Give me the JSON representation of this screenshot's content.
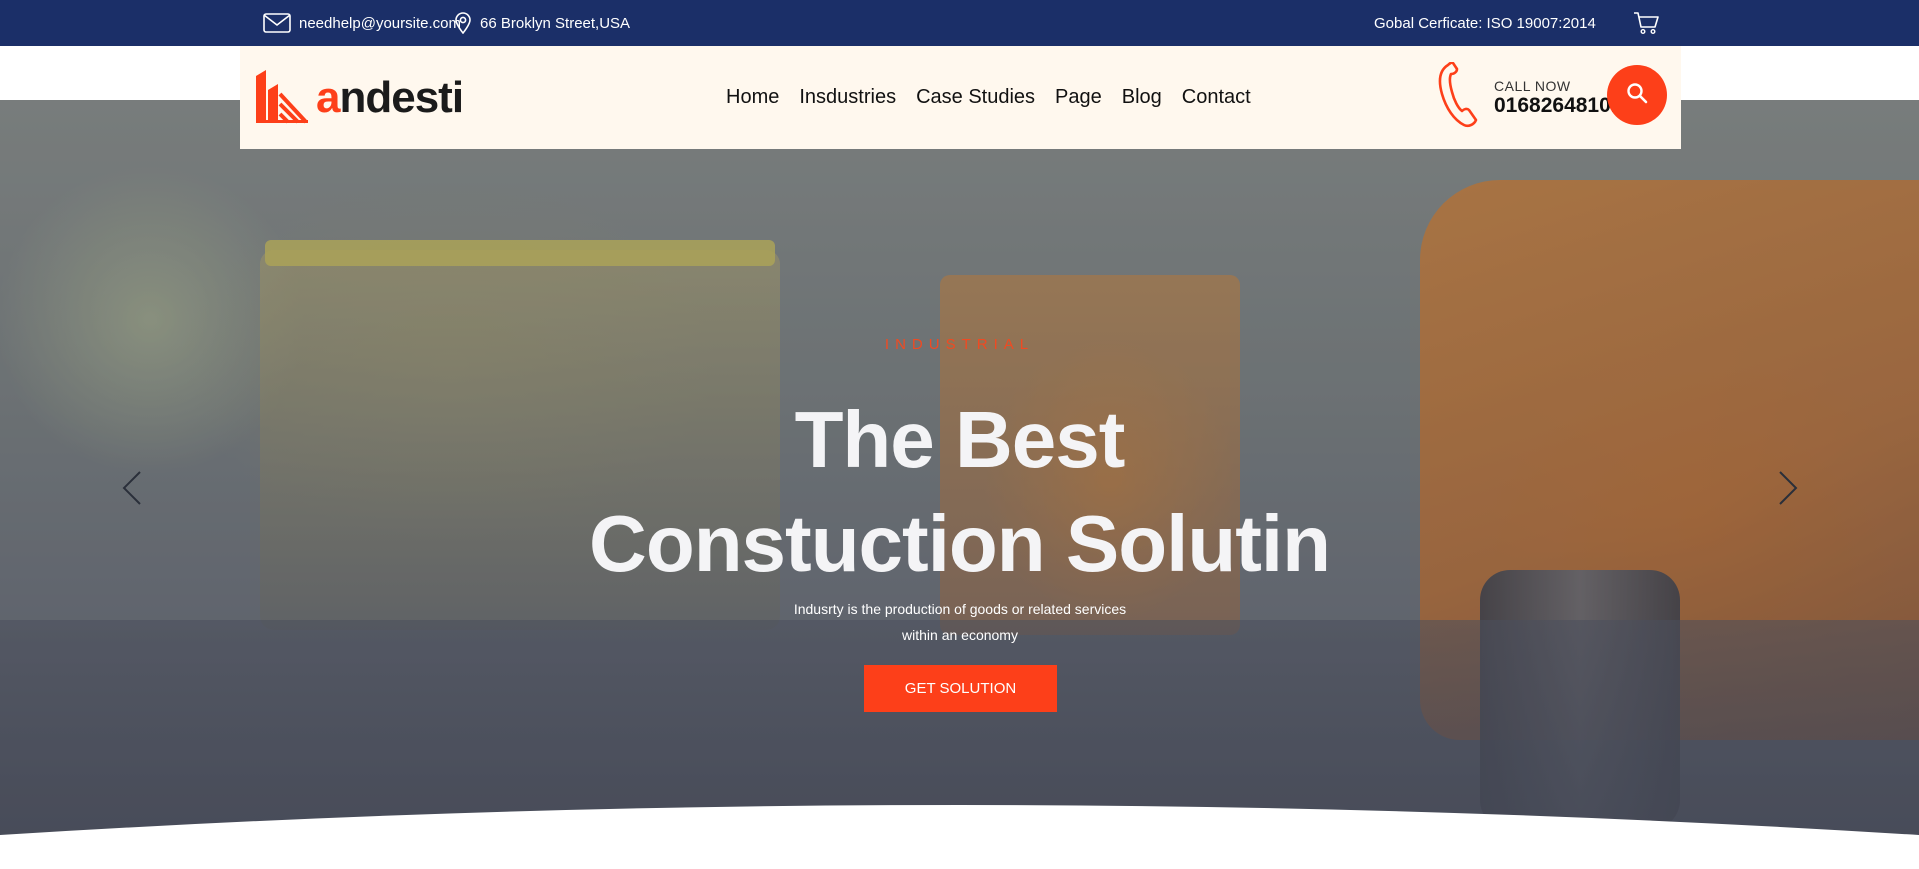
{
  "topbar": {
    "email": "needhelp@yoursite.com",
    "address": "66 Broklyn Street,USA",
    "certificate": "Gobal Cerficate: ISO 19007:2014"
  },
  "header": {
    "logo_first_letter": "a",
    "logo_rest": "ndesti",
    "nav": [
      {
        "label": "Home"
      },
      {
        "label": "Insdustries"
      },
      {
        "label": "Case Studies"
      },
      {
        "label": "Page"
      },
      {
        "label": "Blog"
      },
      {
        "label": "Contact"
      }
    ],
    "call_label": "CALL NOW",
    "call_number": "01682648101"
  },
  "hero": {
    "eyebrow": "INDUSTRIAL",
    "title_line1": "The Best",
    "title_line2": "Constuction Solutin",
    "subtitle": "Indusrty is the production of goods or related services within an economy",
    "cta_label": "GET SOLUTION"
  },
  "colors": {
    "topbar": "#1b2f68",
    "accent": "#fd3f19",
    "header_bg": "#fff8ee"
  },
  "icons": {
    "email": "envelope-icon",
    "address": "map-pin-icon",
    "cart": "cart-icon",
    "phone": "phone-icon",
    "search": "search-icon",
    "prev": "chevron-left-icon",
    "next": "chevron-right-icon"
  }
}
